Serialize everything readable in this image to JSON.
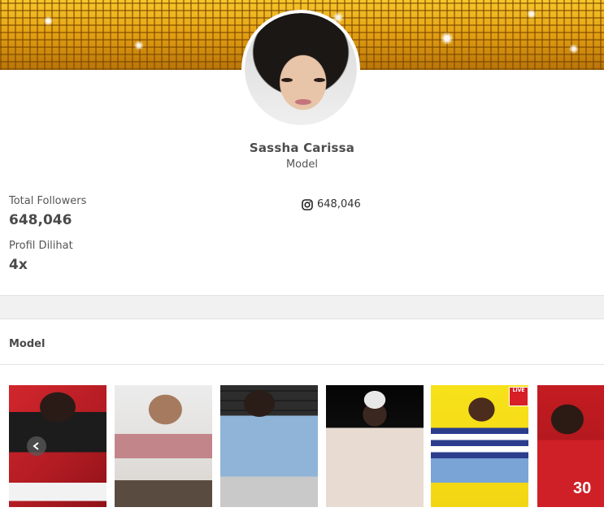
{
  "profile": {
    "name": "Sassha Carissa",
    "role": "Model"
  },
  "stats": {
    "followers_label": "Total Followers",
    "followers_value": "648,046",
    "views_label": "Profil Dilihat",
    "views_value": "4x"
  },
  "social": {
    "instagram_icon": "instagram-icon",
    "instagram_followers": "648,046"
  },
  "section": {
    "title": "Model"
  },
  "gallery": {
    "items": [
      {
        "label": "photo-1"
      },
      {
        "label": "photo-2"
      },
      {
        "label": "photo-3"
      },
      {
        "label": "photo-4"
      },
      {
        "label": "photo-5"
      },
      {
        "label": "photo-6"
      }
    ],
    "overlay_badge": "LIVE",
    "overlay_number": "30"
  },
  "colors": {
    "accent": "#d61f26",
    "divider": "#e3e3e3"
  }
}
